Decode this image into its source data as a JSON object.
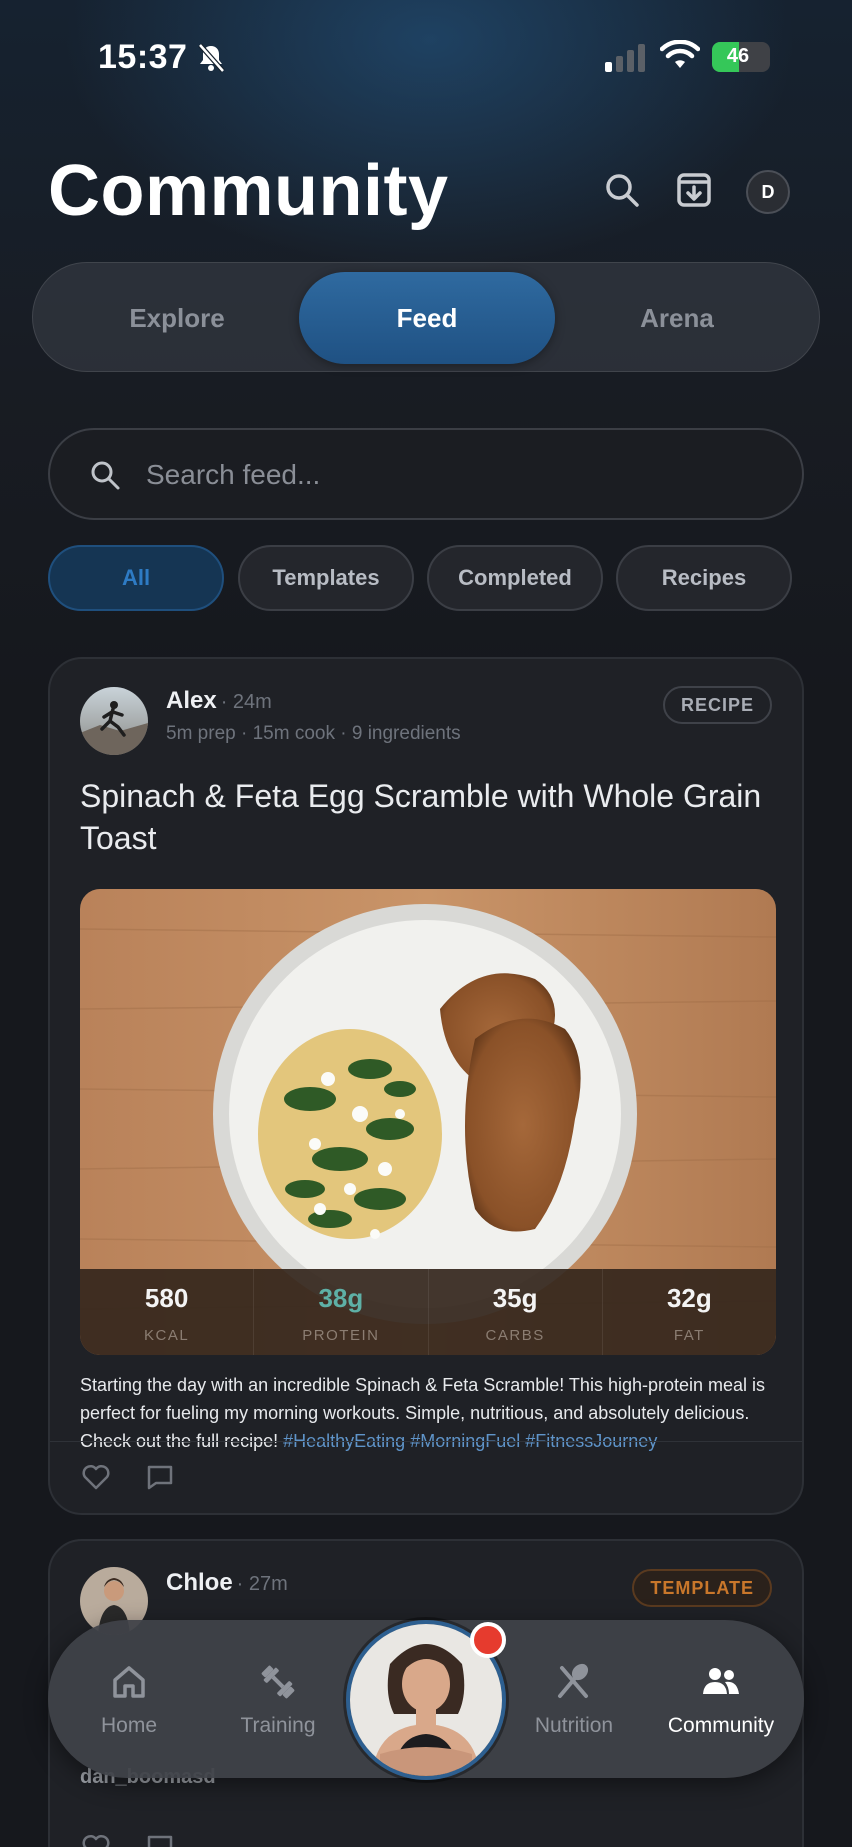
{
  "status_bar": {
    "time": "15:37",
    "battery": "46",
    "battery_percent": 46
  },
  "header": {
    "title": "Community",
    "avatar_initial": "D"
  },
  "segments": [
    {
      "label": "Explore",
      "active": false
    },
    {
      "label": "Feed",
      "active": true
    },
    {
      "label": "Arena",
      "active": false
    }
  ],
  "search": {
    "placeholder": "Search feed..."
  },
  "filters": [
    {
      "label": "All",
      "active": true
    },
    {
      "label": "Templates",
      "active": false
    },
    {
      "label": "Completed",
      "active": false
    },
    {
      "label": "Recipes",
      "active": false
    }
  ],
  "posts": [
    {
      "author": "Alex",
      "time": "· 24m",
      "meta": "5m prep · 15m cook · 9 ingredients",
      "badge": "RECIPE",
      "title": "Spinach & Feta Egg Scramble with Whole Grain Toast",
      "macros": [
        {
          "value": "580",
          "label": "KCAL"
        },
        {
          "value": "38g",
          "label": "PROTEIN"
        },
        {
          "value": "35g",
          "label": "CARBS"
        },
        {
          "value": "32g",
          "label": "FAT"
        }
      ],
      "body": "Starting the day with an incredible Spinach & Feta Scramble! This high-protein meal is perfect for fueling my morning workouts. Simple, nutritious, and absolutely delicious. Check out the full recipe! ",
      "hashtags": "#HealthyEating #MorningFuel #FitnessJourney"
    },
    {
      "author": "Chloe",
      "time": "· 27m",
      "badge": "TEMPLATE",
      "snippet": "dan_boomasd"
    }
  ],
  "tab_bar": {
    "tabs": [
      {
        "label": "Home",
        "icon": "home-icon"
      },
      {
        "label": "Training",
        "icon": "dumbbell-icon"
      },
      {
        "label": "Nutrition",
        "icon": "utensils-icon"
      },
      {
        "label": "Community",
        "icon": "people-icon",
        "active": true
      }
    ]
  },
  "colors": {
    "accent": "#2f6aa0",
    "protein": "#5eb0a6",
    "template": "#c9772b",
    "notification": "#e63b2e"
  }
}
